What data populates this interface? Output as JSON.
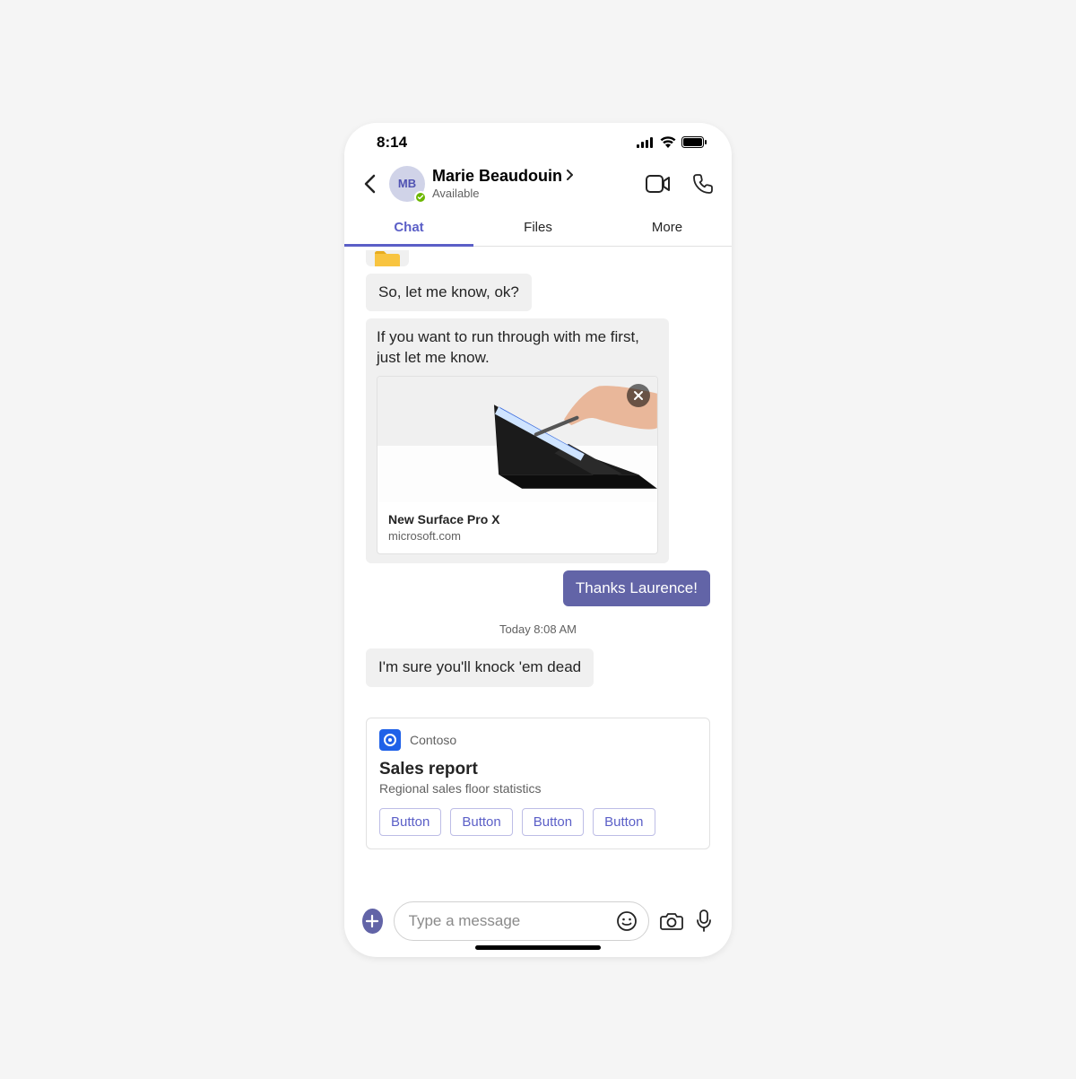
{
  "status_bar": {
    "time": "8:14"
  },
  "header": {
    "avatar_initials": "MB",
    "name": "Marie Beaudouin",
    "presence_text": "Available"
  },
  "tabs": {
    "chat": "Chat",
    "files": "Files",
    "more": "More"
  },
  "messages": {
    "m1": "So, let me know, ok?",
    "m2": "If you want to run through with me first, just let me know.",
    "link_preview": {
      "title": "New Surface Pro X",
      "domain": "microsoft.com"
    },
    "m3": "Thanks Laurence!",
    "timestamp": "Today 8:08 AM",
    "m4": "I'm sure you'll knock 'em dead"
  },
  "card": {
    "app_name": "Contoso",
    "title": "Sales report",
    "subtitle": "Regional sales floor statistics",
    "buttons": [
      "Button",
      "Button",
      "Button",
      "Button"
    ]
  },
  "compose": {
    "placeholder": "Type a message"
  }
}
